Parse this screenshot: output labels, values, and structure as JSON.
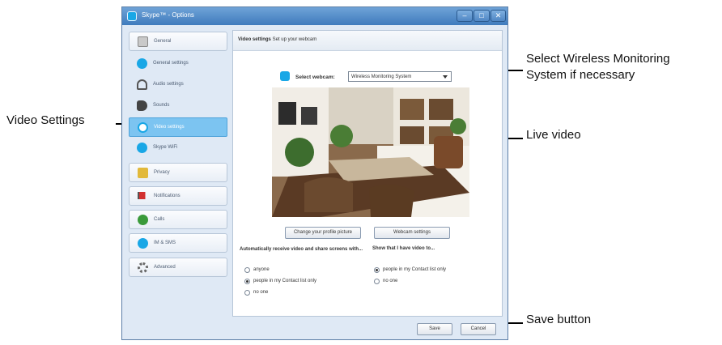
{
  "window": {
    "title": "Skype™ - Options",
    "controls": [
      "–",
      "□",
      "✕"
    ]
  },
  "sidebar": {
    "items": [
      {
        "label": "General",
        "icon": "general-icon"
      },
      {
        "label": "General settings",
        "icon": "skype-icon"
      },
      {
        "label": "Audio settings",
        "icon": "headset-icon"
      },
      {
        "label": "Sounds",
        "icon": "sounds-icon"
      },
      {
        "label": "Video settings",
        "icon": "webcam-icon"
      },
      {
        "label": "Skype WiFi",
        "icon": "wifi-icon"
      },
      {
        "label": "Privacy",
        "icon": "lock-icon"
      },
      {
        "label": "Notifications",
        "icon": "flag-icon"
      },
      {
        "label": "Calls",
        "icon": "phone-icon"
      },
      {
        "label": "IM & SMS",
        "icon": "chat-icon"
      },
      {
        "label": "Advanced",
        "icon": "gear-icon"
      }
    ]
  },
  "panel": {
    "heading_bold": "Video settings",
    "heading_rest": " Set up your webcam",
    "select_label": "Select webcam:",
    "select_value": "Wireless Monitoring System",
    "change_picture_button": "Change your profile picture",
    "webcam_settings_button": "Webcam settings",
    "receive_heading": "Automatically receive video and share screens with...",
    "receive_options": [
      "anyone",
      "people in my Contact list only",
      "no one"
    ],
    "receive_selected": 1,
    "show_heading": "Show that I have video to...",
    "show_options": [
      "people in my Contact list only",
      "no one"
    ],
    "show_selected": 0
  },
  "footer": {
    "save": "Save",
    "cancel": "Cancel"
  },
  "annotations": {
    "select_note_line1": "Select Wireless Monitoring",
    "select_note_line2": "System if necessary",
    "video_settings": "Video Settings",
    "live_video": "Live video",
    "save_button": "Save button"
  },
  "colors": {
    "accent": "#7cc4f1",
    "titlebar": "#4f8bc9",
    "skype_blue": "#19a7e6"
  }
}
